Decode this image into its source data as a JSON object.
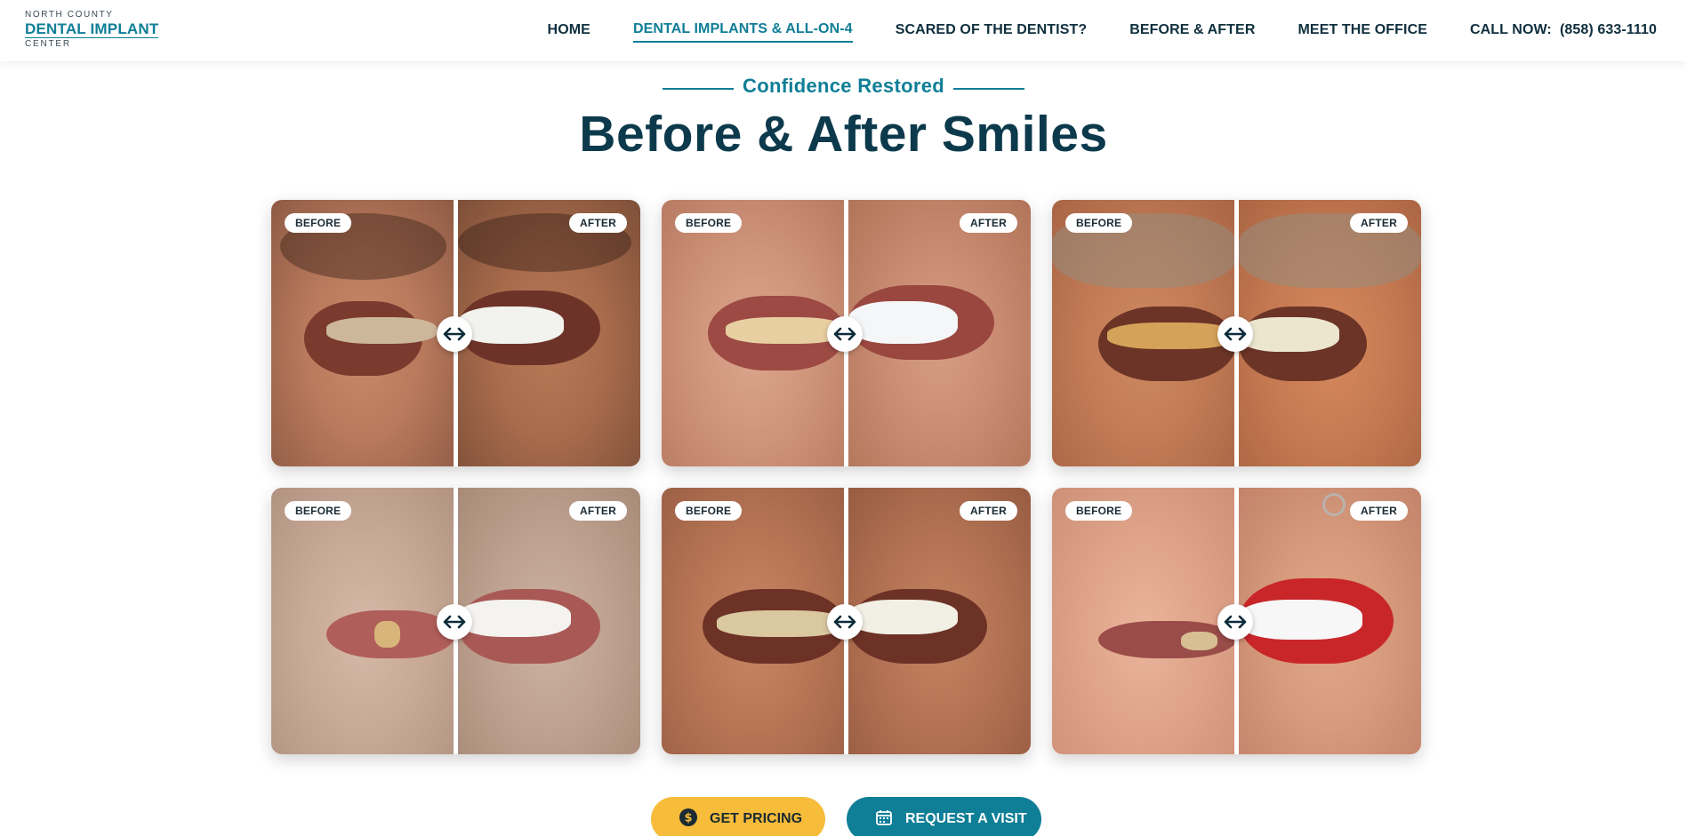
{
  "header": {
    "logo": {
      "line1": "NORTH COUNTY",
      "line2": "DENTAL IMPLANT",
      "line3": "CENTER"
    },
    "nav": [
      {
        "label": "HOME",
        "active": false
      },
      {
        "label": "DENTAL IMPLANTS & ALL-ON-4",
        "active": true
      },
      {
        "label": "SCARED OF THE DENTIST?",
        "active": false
      },
      {
        "label": "BEFORE & AFTER",
        "active": false
      },
      {
        "label": "MEET THE OFFICE",
        "active": false
      },
      {
        "label": "CALL NOW:  (858) 633-1110",
        "active": false
      }
    ]
  },
  "section": {
    "eyebrow": "Confidence Restored",
    "title": "Before & After Smiles"
  },
  "gallery": {
    "before_label": "BEFORE",
    "after_label": "AFTER",
    "cards": [
      {
        "slider_position": 0.5
      },
      {
        "slider_position": 0.5
      },
      {
        "slider_position": 0.5
      },
      {
        "slider_position": 0.5
      },
      {
        "slider_position": 0.5
      },
      {
        "slider_position": 0.5
      }
    ]
  },
  "cta": {
    "pricing_label": "GET PRICING",
    "visit_label": "REQUEST A VISIT"
  },
  "colors": {
    "brand_teal": "#0f7e97",
    "heading_navy": "#0c3a4c",
    "pricing_yellow": "#f6bc3a"
  },
  "icons": {
    "slider_handle": "left-right-arrow-icon",
    "pricing": "dollar-circle-icon",
    "visit": "calendar-icon"
  }
}
